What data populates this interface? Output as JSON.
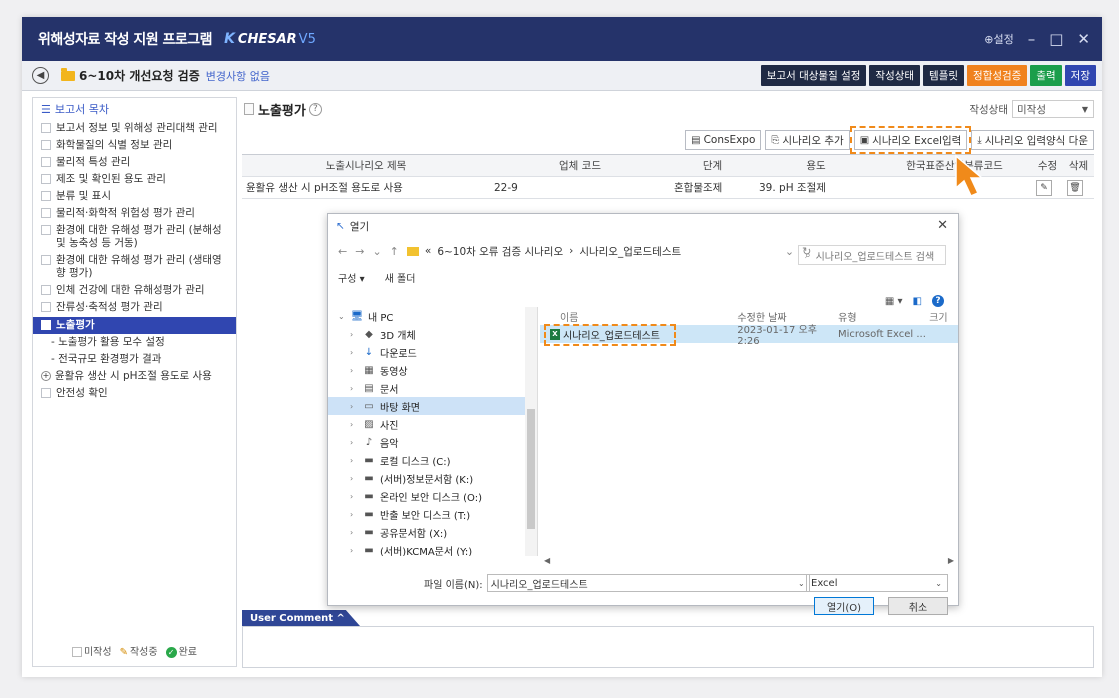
{
  "titlebar": {
    "app_title": "위해성자료 작성 지원 프로그램",
    "logo_text": "CHESAR",
    "logo_version": "V5",
    "settings": "⊕설정"
  },
  "toolbar": {
    "project_title": "6~10차 개선요청 검증",
    "change_state": "변경사항 없음",
    "buttons": [
      {
        "label": "보고서 대상물질 설정",
        "color": "#1f2a44"
      },
      {
        "label": "작성상태",
        "color": "#1f2a44"
      },
      {
        "label": "템플릿",
        "color": "#1f2a44"
      },
      {
        "label": "정합성검증",
        "color": "#f0821e"
      },
      {
        "label": "출력",
        "color": "#1b9e4b"
      },
      {
        "label": "저장",
        "color": "#3046b0"
      }
    ]
  },
  "sidebar": {
    "title": "보고서 목차",
    "items": [
      {
        "label": "보고서 정보 및 위해성 관리대책 관리"
      },
      {
        "label": "화학물질의 식별 정보 관리"
      },
      {
        "label": "물리적 특성 관리"
      },
      {
        "label": "제조 및 확인된 용도 관리"
      },
      {
        "label": "분류 및 표시"
      },
      {
        "label": "물리적·화학적 위험성 평가 관리"
      },
      {
        "label": "환경에 대한 유해성 평가 관리 (분해성 및 농축성 등 거동)"
      },
      {
        "label": "환경에 대한 유해성 평가 관리 (생태영향 평가)"
      },
      {
        "label": "인체 건강에 대한 유해성평가 관리"
      },
      {
        "label": "잔류성·축적성 평가 관리"
      }
    ],
    "active_item": "노출평가",
    "sub_items": [
      "- 노출평가 활용 모수 설정",
      "- 전국규모 환경평가 결과"
    ],
    "scenario_item": "윤활유 생산 시 pH조절 용도로 사용",
    "last_item": "안전성 확인",
    "legend": {
      "todo": "미작성",
      "doing": "작성중",
      "done": "완료"
    }
  },
  "main": {
    "section_title": "노출평가",
    "status_label": "작성상태",
    "status_value": "미작성",
    "actions": [
      {
        "label": "ConsExpo",
        "icon": "▤"
      },
      {
        "label": "시나리오 추가",
        "icon": "⎘"
      },
      {
        "label": "시나리오 Excel입력",
        "icon": "▣"
      },
      {
        "label": "시나리오 입력양식 다운",
        "icon": "⤓"
      }
    ],
    "grid_headers": [
      "노출시나리오 제목",
      "업체 코드",
      "단계",
      "용도",
      "한국표준산업분류코드",
      "수정",
      "삭제"
    ],
    "grid_rows": [
      {
        "title": "윤활유 생산 시 pH조절 용도로 사용",
        "code": "22-9",
        "stage": "혼합물조제",
        "use": "39. pH 조절제",
        "ksic": ""
      }
    ]
  },
  "dialog": {
    "title": "열기",
    "path_prefix": "«",
    "path_folder": "6~10차 오류 검증 시나리오",
    "path_sep": "›",
    "path_current": "시나리오_업로드테스트",
    "search_placeholder": "시나리오_업로드테스트 검색",
    "organize": "구성 ▾",
    "new_folder": "새 폴더",
    "tree": [
      {
        "label": "내 PC",
        "icon": "🖥",
        "expanded": true
      },
      {
        "label": "3D 개체",
        "icon": "◆"
      },
      {
        "label": "다운로드",
        "icon": "↓"
      },
      {
        "label": "동영상",
        "icon": "▦"
      },
      {
        "label": "문서",
        "icon": "▤"
      },
      {
        "label": "바탕 화면",
        "icon": "▭",
        "selected": true
      },
      {
        "label": "사진",
        "icon": "▨"
      },
      {
        "label": "음악",
        "icon": "♪"
      },
      {
        "label": "로컬 디스크 (C:)",
        "icon": "▬"
      },
      {
        "label": "(서버)정보문서함 (K:)",
        "icon": "▬"
      },
      {
        "label": "온라인 보안 디스크 (O:)",
        "icon": "▬"
      },
      {
        "label": "반출 보안 디스크 (T:)",
        "icon": "▬"
      },
      {
        "label": "공유문서함 (X:)",
        "icon": "▬"
      },
      {
        "label": "(서버)KCMA문서 (Y:)",
        "icon": "▬"
      }
    ],
    "file_headers": [
      "이름",
      "수정한 날짜",
      "유형",
      "크기"
    ],
    "files": [
      {
        "name": "시나리오_업로드테스트",
        "date": "2023-01-17 오후 2:26",
        "type": "Microsoft Excel ..."
      }
    ],
    "filename_label": "파일 이름(N):",
    "filename_value": "시나리오_업로드테스트",
    "filetype_value": "Excel",
    "open_button": "열기(O)",
    "cancel_button": "취소"
  },
  "comment": {
    "tab_label": "User Comment ^"
  }
}
